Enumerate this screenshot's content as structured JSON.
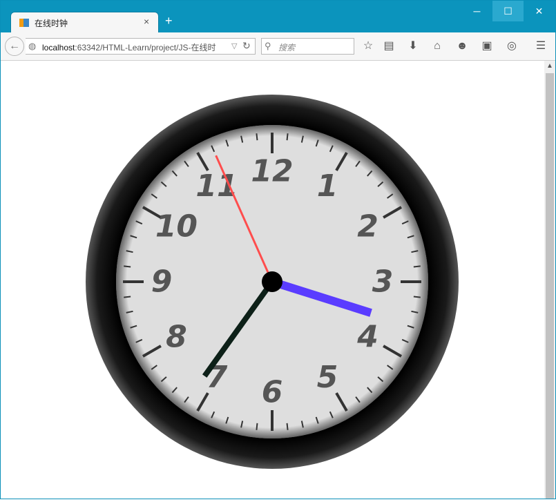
{
  "browser": {
    "tab_title": "在线时钟",
    "new_tab_label": "+",
    "tab_close_label": "×",
    "url_host": "localhost",
    "url_rest": ":63342/HTML-Learn/project/JS-在线时",
    "search_placeholder": "搜索",
    "window_controls": {
      "minimize": "─",
      "maximize": "☐",
      "close": "✕"
    }
  },
  "clock": {
    "numerals": [
      "1",
      "2",
      "3",
      "4",
      "5",
      "6",
      "7",
      "8",
      "9",
      "10",
      "11",
      "12"
    ],
    "time": {
      "hour": 3,
      "minute": 35,
      "second": 56
    },
    "colors": {
      "bezel": "#000000",
      "face": "#dedede",
      "numeral": "#555555",
      "tick": "#333333",
      "hour_hand": "#5a3cff",
      "minute_hand": "#0d2018",
      "second_hand": "#ff4d4d",
      "hub": "#000000"
    }
  },
  "icons": {
    "tab": "sublime-icon",
    "back": "back-arrow-icon",
    "globe": "globe-icon",
    "reload": "reload-icon",
    "search": "search-icon",
    "toolbar": [
      "bookmark-star-icon",
      "reading-list-icon",
      "download-icon",
      "home-icon",
      "chat-icon",
      "extension-icon",
      "dashboard-icon",
      "menu-icon"
    ]
  }
}
